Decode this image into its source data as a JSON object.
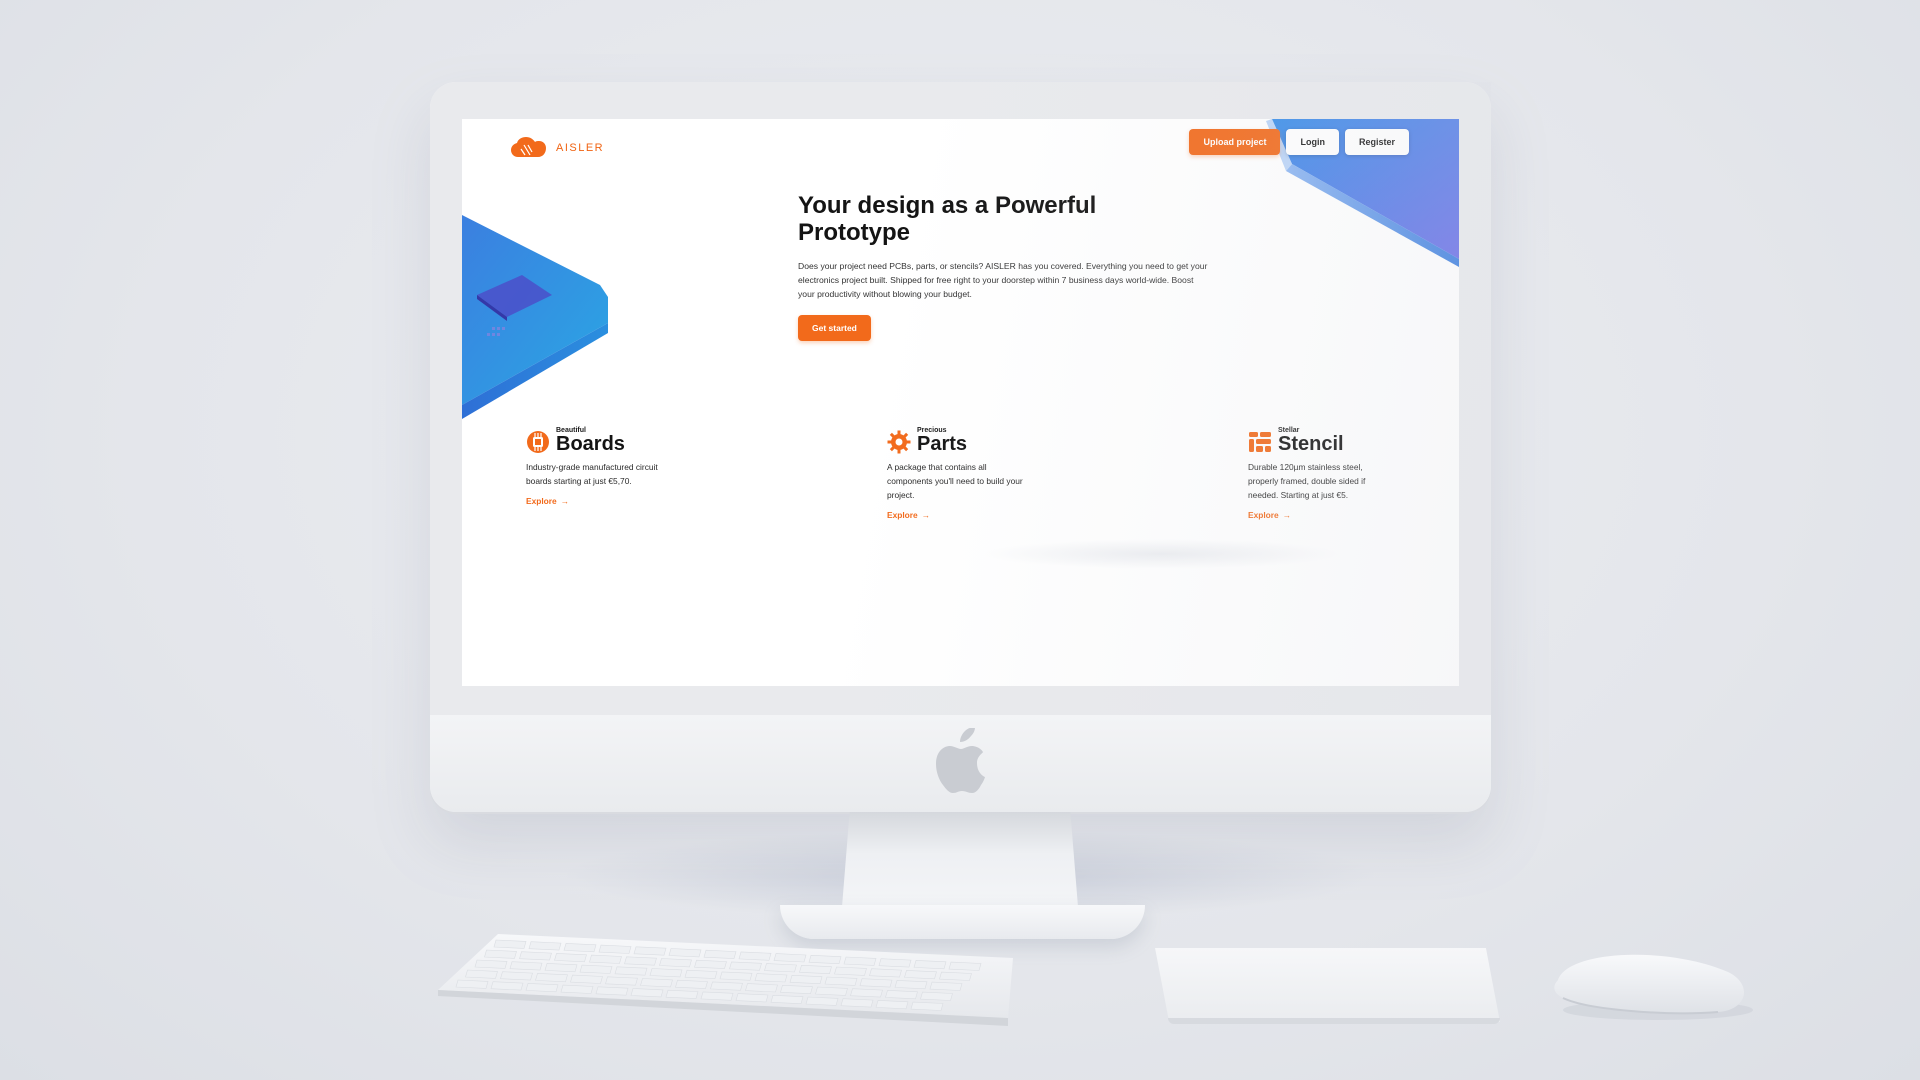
{
  "app": {
    "brand": "AISLER"
  },
  "nav": {
    "upload_label": "Upload project",
    "login_label": "Login",
    "register_label": "Register"
  },
  "hero": {
    "title_line1": "Your design as a Powerful",
    "title_line2": "Prototype",
    "text": "Does your project need PCBs, parts, or stencils? AISLER has you covered. Everything you need to get your electronics project built. Shipped for free right to your doorstep within 7 business days world-wide. Boost your productivity without blowing your budget.",
    "cta_label": "Get started"
  },
  "features": [
    {
      "kicker": "Beautiful",
      "title": "Boards",
      "desc": "Industry-grade manufactured circuit boards starting at just €5,70.",
      "link": "Explore",
      "icon": "chip-icon"
    },
    {
      "kicker": "Precious",
      "title": "Parts",
      "desc": "A package that contains all components you'll need to build your project.",
      "link": "Explore",
      "icon": "gear-icon"
    },
    {
      "kicker": "Stellar",
      "title": "Stencil",
      "desc": "Durable 120µm stainless steel, properly framed, double sided if needed. Starting at just €5.",
      "link": "Explore",
      "icon": "stencil-icon"
    }
  ],
  "colors": {
    "accent": "#f26a1b",
    "blue": "#3f8ee3",
    "purple": "#6a6fe6"
  }
}
